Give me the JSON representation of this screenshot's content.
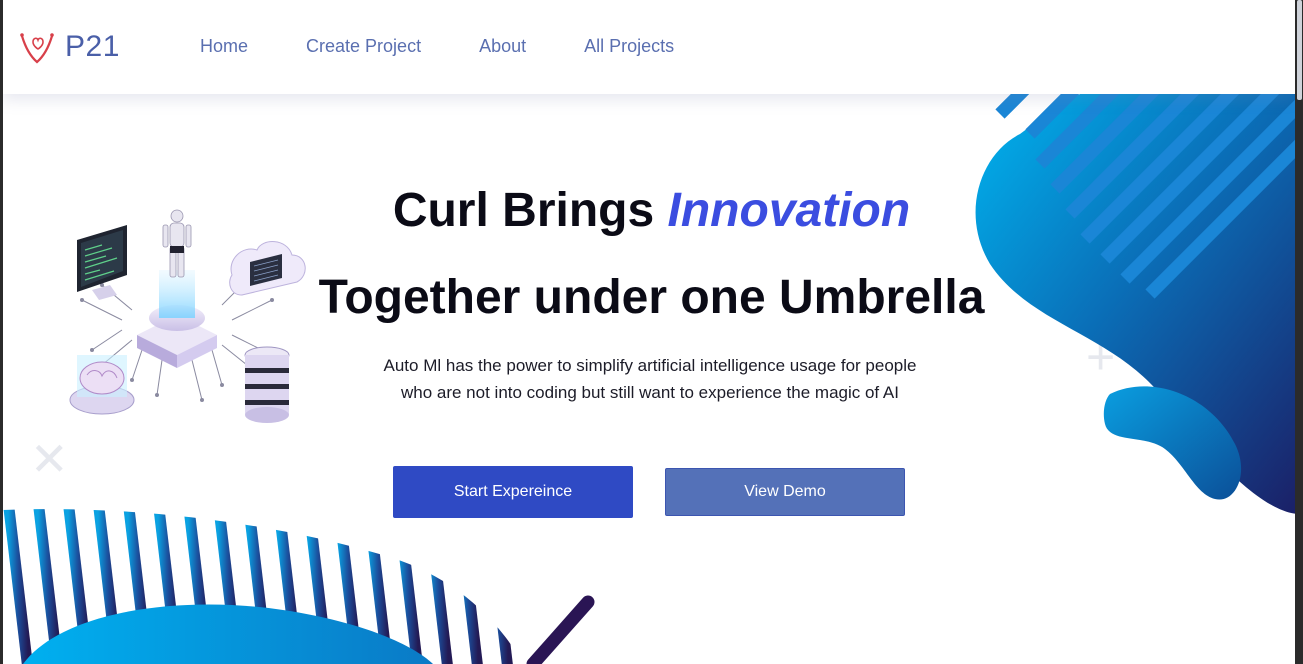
{
  "brand": {
    "name": "P21",
    "logo_icon": "v-heart-logo-icon"
  },
  "nav": {
    "links": [
      {
        "label": "Home"
      },
      {
        "label": "Create Project"
      },
      {
        "label": "About"
      },
      {
        "label": "All Projects"
      }
    ]
  },
  "hero": {
    "title_prefix": "Curl Brings",
    "title_highlight": "Innovation",
    "title_line2": "Together under one Umbrella",
    "description": "Auto Ml has the power to simplify artificial intelligence usage for people who are not into coding but still want to experience the magic of AI",
    "primary_button": "Start Expereince",
    "secondary_button": "View Demo",
    "illustration": "ai-robot-circuit-illustration"
  },
  "colors": {
    "accent": "#3b4de0",
    "primary_button": "#2f4ac4",
    "secondary_button": "#5471b8",
    "nav_text": "#5a6fb0",
    "blob_light": "#00a8e8",
    "blob_dark": "#1a1f5e"
  }
}
